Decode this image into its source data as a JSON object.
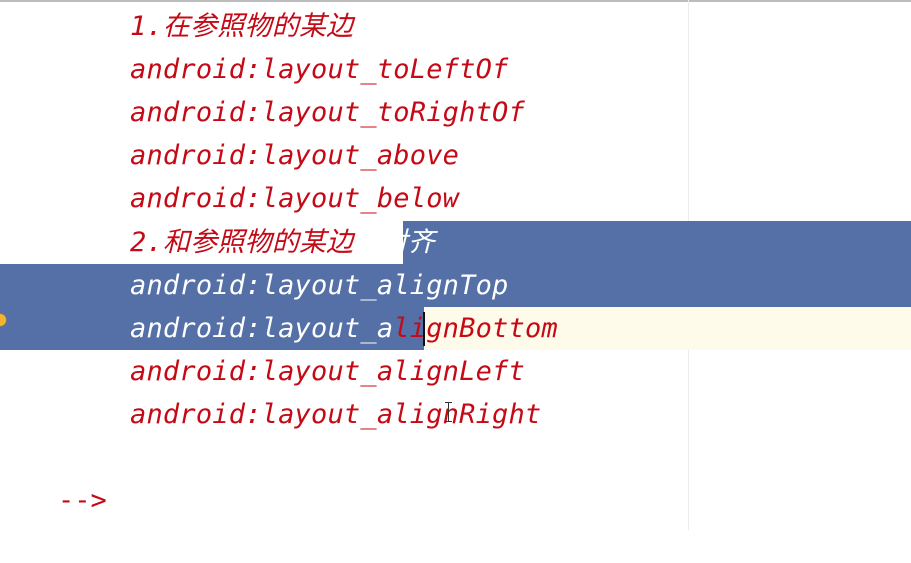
{
  "editor": {
    "lines": [
      "1.在参照物的某边",
      "android:layout_toLeftOf",
      "android:layout_toRightOf",
      "android:layout_above",
      "android:layout_below",
      "2.和参照物的某边线对齐",
      "android:layout_alignTop",
      "android:layout_alignBottom",
      "android:layout_alignLeft",
      "android:layout_alignRight"
    ],
    "line6_parts": [
      "2.和参照物的某边",
      "线对齐"
    ],
    "line8_parts": [
      "android:layout_a",
      "lignBottom"
    ],
    "comment_end": "-->"
  },
  "colors": {
    "code_text": "#c40a16",
    "selection": "#5470a6",
    "current_line": "#fffbea",
    "marker": "#f5b530"
  },
  "icons": {
    "gutter_marker": "warning-dot-icon",
    "cursor": "text-cursor-icon"
  }
}
